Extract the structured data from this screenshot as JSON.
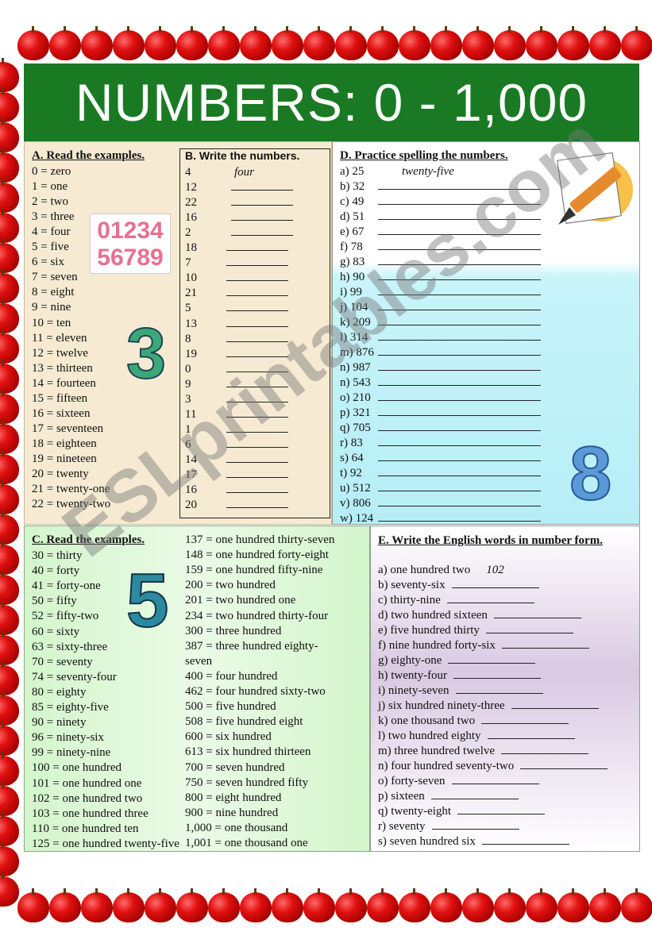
{
  "title": "NUMBERS: 0 - 1,000",
  "watermark": "ESLprintables.com",
  "colors": {
    "banner": "#1a7a24",
    "apple": "#e01010",
    "panel_ab": "#f6ebd2",
    "panel_c": "#d4f5cc",
    "panel_d": "#b6eef6",
    "panel_e": "#d9c9e2"
  },
  "section_a": {
    "heading": "A.  Read the examples.",
    "items": [
      "0 = zero",
      "1 = one",
      "2 = two",
      "3 = three",
      "4 = four",
      "5 = five",
      "6 = six",
      "7 = seven",
      "8 = eight",
      "9 = nine",
      "10 = ten",
      "11 = eleven",
      "12 = twelve",
      "13 = thirteen",
      "14 = fourteen",
      "15 = fifteen",
      "16 = sixteen",
      "17 = seventeen",
      "18 = eighteen",
      "19 = nineteen",
      "20 = twenty",
      "21 = twenty-one",
      "22 = twenty-two"
    ]
  },
  "section_b": {
    "heading": "B.  Write the numbers.",
    "example_answer": "four",
    "items": [
      "4",
      "12",
      "22",
      "16",
      "2",
      "18",
      "7",
      "10",
      "21",
      "5",
      "13",
      "8",
      "19",
      "0",
      "9",
      "3",
      "11",
      "1",
      "6",
      "14",
      "17",
      "16",
      "20"
    ]
  },
  "section_c": {
    "heading": "C.  Read the examples.",
    "col1": [
      "30 = thirty",
      "40 = forty",
      "41 = forty-one",
      "50 = fifty",
      "52 = fifty-two",
      "60 = sixty",
      "63 = sixty-three",
      "70 = seventy",
      "74 = seventy-four",
      "80 = eighty",
      "85 = eighty-five",
      "90 = ninety",
      "96 = ninety-six",
      "99 = ninety-nine",
      "100 = one hundred",
      "101 = one hundred one",
      "102 = one hundred two",
      "103 = one hundred three",
      "110 = one hundred ten",
      "125 = one hundred twenty-five"
    ],
    "col2": [
      "137 = one hundred thirty-seven",
      "148 = one hundred forty-eight",
      "159 = one hundred fifty-nine",
      "200 = two hundred",
      "201 = two hundred one",
      "234 = two hundred thirty-four",
      "300 = three hundred",
      "387  = three hundred eighty-",
      "seven",
      "400 = four hundred",
      "462 = four hundred sixty-two",
      "500 = five hundred",
      "508 = five hundred eight",
      "600 = six hundred",
      "613 = six hundred thirteen",
      "700 = seven hundred",
      "750 = seven hundred fifty",
      "800 = eight hundred",
      "900 = nine hundred",
      "1,000 = one thousand",
      "1,001 = one thousand one"
    ]
  },
  "section_d": {
    "heading": "D.  Practice spelling the numbers.",
    "example_answer": "twenty-five",
    "items": [
      "a)  25",
      "b)  32",
      "c) 49",
      "d) 51",
      "e)  67",
      "f)  78",
      "g)  83",
      "h)  90",
      "i)  99",
      "j)  104",
      "k)  209",
      "l)  314",
      "m)  876",
      "n)  987",
      "n) 543",
      "o)  210",
      "p)  321",
      "q)  705",
      "r)  83",
      "s)  64",
      "t)  92",
      "u)  512",
      "v)  806",
      "w)  124"
    ]
  },
  "section_e": {
    "heading": "E.  Write the English words in number form.",
    "example_answer": "102",
    "items": [
      "a)  one hundred two",
      "b)  seventy-six",
      "c)  thirty-nine",
      "d)  two hundred sixteen",
      "e)  five hundred thirty",
      "f)  nine hundred forty-six",
      "g)  eighty-one",
      "h)  twenty-four",
      "i)  ninety-seven",
      "j)  six hundred ninety-three",
      "k)  one thousand two",
      "l)  two hundred eighty",
      "m)  three hundred twelve",
      "n)  four hundred seventy-two",
      "o)  forty-seven",
      "p)  sixteen",
      "q)  twenty-eight",
      "r)  seventy",
      "s)  seven hundred six"
    ]
  },
  "images": {
    "digits_picture": "0123456789",
    "big_digit_a": "3",
    "big_digit_c": "5",
    "big_digit_d": "8",
    "pencil_icon": "pencil-notebook"
  }
}
